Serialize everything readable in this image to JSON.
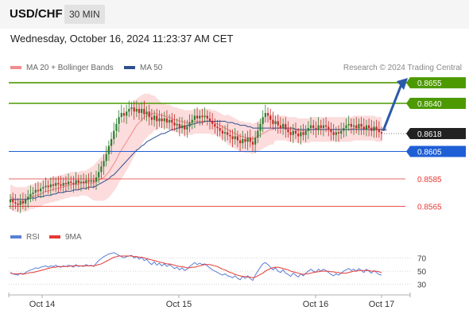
{
  "header": {
    "symbol": "USD/CHF",
    "timeframe": "30 MIN"
  },
  "datetime": "Wednesday, October 16, 2024 11:23:37 AM CET",
  "legend": {
    "ma20": "MA 20 + Bollinger Bands",
    "ma50": "MA 50"
  },
  "credit": "Research © 2024 Trading Central",
  "rsi_legend": {
    "rsi": "RSI",
    "ma": "9MA"
  },
  "colors": {
    "green": "#4c9a00",
    "blue": "#1f5fd6",
    "red": "#e53935",
    "up": "#2e7d32",
    "down": "#c62828",
    "ma20": "#f28b8b",
    "band": "#fbd3d3",
    "ma50": "#2f4f8f",
    "dark": "#222222",
    "arrow": "#2a5aa8",
    "rsi": "#5a7fd6",
    "rsi_ma": "#e53935"
  },
  "chart_data": [
    {
      "type": "candlestick",
      "title": "USD/CHF",
      "timeframe": "30 MIN",
      "ylim": [
        0.8552,
        0.8662
      ],
      "x_tick_labels": [
        "Oct 14",
        "Oct 15",
        "Oct 16",
        "Oct 17"
      ],
      "current_price": 0.8618,
      "levels": [
        {
          "label": "0.8655",
          "value": 0.8655,
          "style": "resistance"
        },
        {
          "label": "0.8640",
          "value": 0.864,
          "style": "resistance"
        },
        {
          "label": "0.8618",
          "value": 0.8618,
          "style": "current"
        },
        {
          "label": "0.8605",
          "value": 0.8605,
          "style": "pivot"
        },
        {
          "label": "0.8585",
          "value": 0.8585,
          "style": "support"
        },
        {
          "label": "0.8565",
          "value": 0.8565,
          "style": "support"
        }
      ],
      "series": [
        {
          "name": "MA 20 + Bollinger Bands"
        },
        {
          "name": "MA 50"
        }
      ],
      "closes": [
        0.857,
        0.8568,
        0.8567,
        0.8566,
        0.8569,
        0.8567,
        0.857,
        0.8572,
        0.8574,
        0.8575,
        0.8577,
        0.8576,
        0.8578,
        0.8579,
        0.858,
        0.8579,
        0.8581,
        0.858,
        0.8582,
        0.8581,
        0.858,
        0.8582,
        0.8581,
        0.8583,
        0.8582,
        0.8581,
        0.8584,
        0.8582,
        0.8583,
        0.8582,
        0.8584,
        0.8583,
        0.8584,
        0.8583,
        0.8586,
        0.859,
        0.8594,
        0.8598,
        0.8603,
        0.8609,
        0.8614,
        0.862,
        0.8625,
        0.863,
        0.8633,
        0.8631,
        0.8634,
        0.8636,
        0.8637,
        0.8634,
        0.8636,
        0.8633,
        0.8636,
        0.8632,
        0.8634,
        0.863,
        0.8628,
        0.8631,
        0.8627,
        0.8629,
        0.8627,
        0.8629,
        0.8626,
        0.8628,
        0.8626,
        0.8624,
        0.8625,
        0.8622,
        0.8624,
        0.8621,
        0.8623,
        0.8626,
        0.8628,
        0.8631,
        0.8629,
        0.8631,
        0.863,
        0.8631,
        0.8629,
        0.8627,
        0.8625,
        0.8623,
        0.8622,
        0.862,
        0.8618,
        0.8619,
        0.8617,
        0.8616,
        0.8614,
        0.8616,
        0.8613,
        0.8611,
        0.8614,
        0.8612,
        0.8615,
        0.8612,
        0.861,
        0.8615,
        0.862,
        0.8625,
        0.863,
        0.8633,
        0.8631,
        0.8628,
        0.8625,
        0.8627,
        0.8624,
        0.8622,
        0.8625,
        0.8621,
        0.8619,
        0.8617,
        0.862,
        0.8618,
        0.8616,
        0.8619,
        0.8617,
        0.862,
        0.8622,
        0.8624,
        0.8622,
        0.8621,
        0.8624,
        0.8622,
        0.8624,
        0.8623,
        0.8621,
        0.8619,
        0.8617,
        0.8619,
        0.8618,
        0.862,
        0.8622,
        0.8624,
        0.8625,
        0.8623,
        0.8624,
        0.8622,
        0.8625,
        0.8623,
        0.8621,
        0.8624,
        0.8622,
        0.862,
        0.8623,
        0.8621,
        0.8619,
        0.8618
      ],
      "ma20": [
        0.8572,
        0.8571,
        0.857,
        0.857,
        0.857,
        0.857,
        0.857,
        0.8571,
        0.8572,
        0.8572,
        0.8573,
        0.8573,
        0.8574,
        0.8575,
        0.8576,
        0.8576,
        0.8577,
        0.8577,
        0.8578,
        0.8578,
        0.8579,
        0.8579,
        0.858,
        0.858,
        0.8581,
        0.8581,
        0.8581,
        0.8581,
        0.8582,
        0.8582,
        0.8582,
        0.8582,
        0.8582,
        0.8582,
        0.8583,
        0.8584,
        0.8585,
        0.8586,
        0.8588,
        0.859,
        0.8593,
        0.8596,
        0.8599,
        0.8603,
        0.8606,
        0.8609,
        0.8612,
        0.8615,
        0.8618,
        0.8621,
        0.8624,
        0.8626,
        0.8628,
        0.863,
        0.8631,
        0.8632,
        0.8632,
        0.8633,
        0.8632,
        0.8632,
        0.8631,
        0.8631,
        0.863,
        0.863,
        0.8629,
        0.8628,
        0.8628,
        0.8627,
        0.8627,
        0.8626,
        0.8626,
        0.8626,
        0.8626,
        0.8627,
        0.8627,
        0.8627,
        0.8627,
        0.8627,
        0.8627,
        0.8627,
        0.8626,
        0.8626,
        0.8625,
        0.8624,
        0.8623,
        0.8622,
        0.8621,
        0.862,
        0.8619,
        0.8618,
        0.8617,
        0.8616,
        0.8616,
        0.8615,
        0.8615,
        0.8615,
        0.8614,
        0.8615,
        0.8616,
        0.8617,
        0.8618,
        0.8619,
        0.862,
        0.8621,
        0.8621,
        0.8622,
        0.8622,
        0.8622,
        0.8622,
        0.8622,
        0.8621,
        0.8621,
        0.8621,
        0.8621,
        0.862,
        0.862,
        0.862,
        0.862,
        0.862,
        0.8621,
        0.8621,
        0.8621,
        0.8621,
        0.8621,
        0.8621,
        0.8621,
        0.8621,
        0.8621,
        0.8621,
        0.8621,
        0.8621,
        0.8621,
        0.8621,
        0.8621,
        0.8621,
        0.8621,
        0.8622,
        0.8622,
        0.8622,
        0.8622,
        0.8622,
        0.8622,
        0.8622,
        0.8622,
        0.8622,
        0.8621,
        0.8621,
        0.8621,
        0.8621,
        0.862
      ],
      "ma50": [
        0.857,
        0.857,
        0.857,
        0.857,
        0.857,
        0.857,
        0.857,
        0.857,
        0.8571,
        0.8571,
        0.8571,
        0.8572,
        0.8572,
        0.8572,
        0.8573,
        0.8573,
        0.8573,
        0.8574,
        0.8574,
        0.8575,
        0.8575,
        0.8575,
        0.8576,
        0.8576,
        0.8576,
        0.8577,
        0.8577,
        0.8577,
        0.8578,
        0.8578,
        0.8578,
        0.8579,
        0.8579,
        0.8579,
        0.858,
        0.8581,
        0.8582,
        0.8583,
        0.8584,
        0.8585,
        0.8587,
        0.8588,
        0.859,
        0.8592,
        0.8594,
        0.8596,
        0.8598,
        0.86,
        0.8602,
        0.8604,
        0.8606,
        0.8607,
        0.8609,
        0.861,
        0.8612,
        0.8613,
        0.8614,
        0.8615,
        0.8616,
        0.8617,
        0.8618,
        0.8618,
        0.8619,
        0.862,
        0.8621,
        0.8621,
        0.8622,
        0.8622,
        0.8623,
        0.8623,
        0.8624,
        0.8624,
        0.8625,
        0.8625,
        0.8626,
        0.8626,
        0.8626,
        0.8627,
        0.8627,
        0.8627,
        0.8627,
        0.8627,
        0.8627,
        0.8627,
        0.8627,
        0.8627,
        0.8626,
        0.8626,
        0.8626,
        0.8625,
        0.8625,
        0.8624,
        0.8624,
        0.8624,
        0.8623,
        0.8623,
        0.8622,
        0.8622,
        0.8622,
        0.8622,
        0.8622,
        0.8622,
        0.8622,
        0.8622,
        0.8622,
        0.8622,
        0.8622,
        0.8622,
        0.8622,
        0.8622,
        0.8622,
        0.8622,
        0.8622,
        0.8621,
        0.8621,
        0.8621,
        0.8621,
        0.8621,
        0.8621,
        0.8621,
        0.8621,
        0.8621,
        0.8621,
        0.8621,
        0.8621,
        0.8621,
        0.8621,
        0.8621,
        0.8621,
        0.8621,
        0.8621,
        0.8621,
        0.8621,
        0.8621,
        0.8621,
        0.8621,
        0.8621,
        0.8621,
        0.8621,
        0.8621,
        0.8621,
        0.8621,
        0.8621,
        0.8621,
        0.8621,
        0.8621,
        0.8621,
        0.8621,
        0.8621,
        0.8621
      ]
    },
    {
      "type": "line",
      "title": "RSI",
      "ylim": [
        20,
        85
      ],
      "y_ticks": [
        70,
        50,
        30
      ],
      "series": [
        {
          "name": "RSI",
          "values": [
            48,
            46,
            45,
            44,
            47,
            45,
            48,
            50,
            52,
            53,
            55,
            54,
            56,
            57,
            58,
            56,
            58,
            57,
            59,
            57,
            56,
            58,
            57,
            59,
            58,
            56,
            60,
            57,
            58,
            57,
            60,
            58,
            59,
            57,
            62,
            66,
            69,
            72,
            74,
            76,
            77,
            78,
            76,
            74,
            72,
            70,
            72,
            73,
            74,
            70,
            72,
            68,
            71,
            66,
            68,
            63,
            60,
            64,
            59,
            62,
            58,
            61,
            57,
            60,
            57,
            54,
            56,
            52,
            55,
            51,
            53,
            57,
            60,
            63,
            60,
            62,
            60,
            61,
            58,
            55,
            52,
            50,
            48,
            46,
            44,
            46,
            43,
            42,
            40,
            43,
            39,
            37,
            42,
            39,
            43,
            39,
            36,
            44,
            50,
            56,
            61,
            63,
            60,
            56,
            52,
            55,
            50,
            48,
            52,
            47,
            45,
            42,
            47,
            44,
            41,
            46,
            43,
            47,
            50,
            53,
            50,
            48,
            53,
            50,
            53,
            51,
            48,
            45,
            43,
            46,
            44,
            47,
            50,
            52,
            54,
            51,
            53,
            50,
            54,
            51,
            48,
            53,
            50,
            47,
            51,
            48,
            45,
            44
          ]
        },
        {
          "name": "9MA",
          "values": [
            47,
            46,
            46,
            46,
            46,
            46,
            46,
            47,
            48,
            48,
            49,
            50,
            51,
            52,
            53,
            54,
            55,
            56,
            56,
            57,
            57,
            57,
            57,
            57,
            58,
            58,
            58,
            58,
            58,
            58,
            58,
            58,
            58,
            58,
            59,
            60,
            61,
            63,
            65,
            67,
            69,
            71,
            72,
            73,
            73,
            73,
            73,
            73,
            73,
            72,
            72,
            71,
            71,
            70,
            69,
            68,
            67,
            66,
            65,
            64,
            63,
            62,
            61,
            61,
            60,
            59,
            58,
            57,
            57,
            56,
            55,
            55,
            56,
            56,
            57,
            58,
            59,
            60,
            60,
            60,
            59,
            58,
            57,
            55,
            53,
            52,
            50,
            48,
            47,
            45,
            44,
            43,
            42,
            42,
            41,
            41,
            40,
            41,
            43,
            45,
            47,
            50,
            52,
            54,
            55,
            56,
            56,
            55,
            54,
            53,
            52,
            50,
            49,
            48,
            47,
            46,
            45,
            46,
            46,
            47,
            48,
            49,
            49,
            50,
            50,
            50,
            50,
            49,
            49,
            48,
            48,
            47,
            47,
            47,
            48,
            49,
            50,
            50,
            51,
            51,
            51,
            51,
            51,
            50,
            50,
            50,
            49,
            48
          ]
        }
      ]
    }
  ]
}
